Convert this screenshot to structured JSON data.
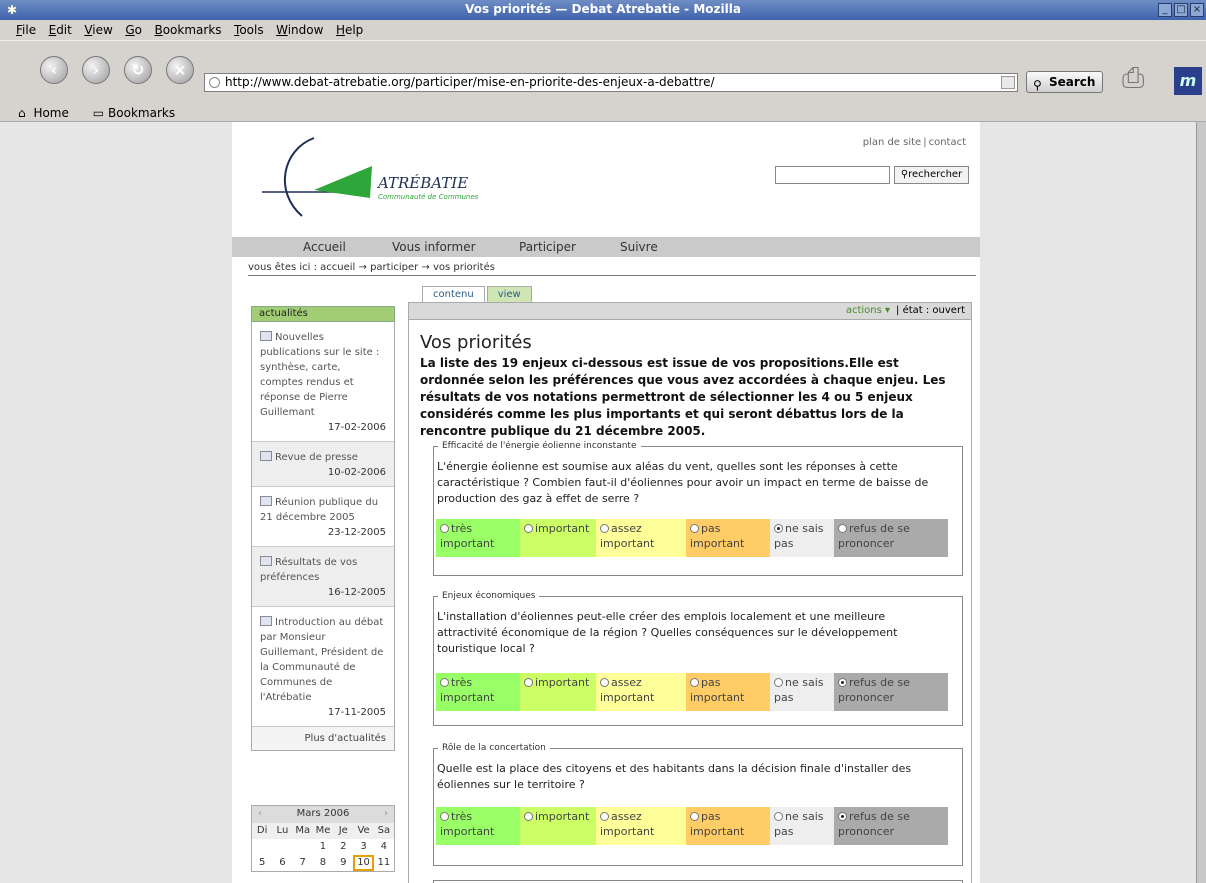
{
  "window": {
    "title": "Vos priorités — Debat Atrebatie - Mozilla"
  },
  "menu": [
    "File",
    "Edit",
    "View",
    "Go",
    "Bookmarks",
    "Tools",
    "Window",
    "Help"
  ],
  "toolbar": {
    "url": "http://www.debat-atrebatie.org/participer/mise-en-priorite-des-enjeux-a-debattre/",
    "search_label": "Search"
  },
  "personal_bar": {
    "home": "Home",
    "bookmarks": "Bookmarks"
  },
  "site": {
    "toplinks": [
      "plan de site",
      "contact"
    ],
    "logo_title": "ATRÉBATIE",
    "logo_subtitle": "Communauté de Communes",
    "search_button": "rechercher",
    "nav": [
      "Accueil",
      "Vous informer",
      "Participer",
      "Suivre"
    ],
    "breadcrumb": "vous êtes ici : accueil → participer → vos priorités"
  },
  "news": {
    "heading": "actualités",
    "items": [
      {
        "title": "Nouvelles publications sur le site : synthèse, carte, comptes rendus et réponse de Pierre Guillemant",
        "date": "17-02-2006"
      },
      {
        "title": "Revue de presse",
        "date": "10-02-2006"
      },
      {
        "title": "Réunion publique du 21 décembre 2005",
        "date": "23-12-2005"
      },
      {
        "title": "Résultats de vos préférences",
        "date": "16-12-2005"
      },
      {
        "title": "Introduction au débat par Monsieur Guillemant, Président de la Communauté de Communes de l'Atrébatie",
        "date": "17-11-2005"
      }
    ],
    "more": "Plus d'actualités"
  },
  "calendar": {
    "month": "Mars 2006",
    "days_of_week": [
      "Di",
      "Lu",
      "Ma",
      "Me",
      "Je",
      "Ve",
      "Sa"
    ],
    "row1": [
      "",
      "",
      "",
      "1",
      "2",
      "3",
      "4"
    ],
    "row2": [
      "5",
      "6",
      "7",
      "8",
      "9",
      "10",
      "11"
    ],
    "today": "10"
  },
  "content": {
    "tabs": [
      "contenu",
      "view"
    ],
    "actions": "actions",
    "state": "état : ouvert",
    "title": "Vos priorités",
    "intro": "La liste des 19 enjeux ci-dessous est issue de vos propositions.Elle est ordonnée selon les préférences que vous avez accordées à chaque enjeu. Les résultats de vos notations permettront de sélectionner les 4 ou 5 enjeux considérés comme les plus importants et qui seront débattus lors de la rencontre publique du 21 décembre 2005.",
    "options": [
      "très important",
      "important",
      "assez important",
      "pas important",
      "ne sais pas",
      "refus de se prononcer"
    ],
    "issues": [
      {
        "title": "Efficacité de l'énergie éolienne inconstante",
        "question": "L'énergie éolienne est soumise aux aléas du vent, quelles sont les réponses à cette caractéristique ? Combien faut-il d'éoliennes pour avoir un impact en terme de baisse de production des gaz à effet de serre ?",
        "selected": "ne sais pas"
      },
      {
        "title": "Enjeux économiques",
        "question": "L'installation d'éoliennes peut-elle créer des emplois localement et une meilleure attractivité économique de la région ? Quelles conséquences sur le développement touristique local ?",
        "selected": "refus de se prononcer"
      },
      {
        "title": "Rôle de la concertation",
        "question": "Quelle est la place des citoyens et des habitants dans la décision finale d'installer des éoliennes sur le territoire ?",
        "selected": "refus de se prononcer"
      }
    ]
  }
}
